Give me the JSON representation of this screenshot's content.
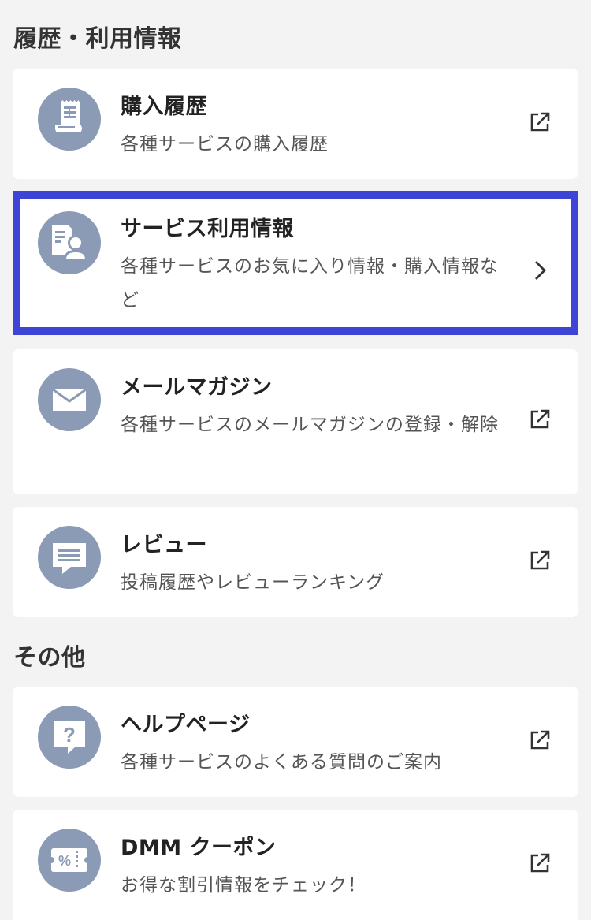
{
  "sections": [
    {
      "title": "履歴・利用情報",
      "items": [
        {
          "title": "購入履歴",
          "description": "各種サービスの購入履歴",
          "icon": "receipt-icon",
          "action_icon": "external-link-icon"
        },
        {
          "title": "サービス利用情報",
          "description": "各種サービスのお気に入り情報・購入情報など",
          "icon": "user-document-icon",
          "action_icon": "chevron-right-icon"
        },
        {
          "title": "メールマガジン",
          "description": "各種サービスのメールマガジンの登録・解除",
          "icon": "mail-icon",
          "action_icon": "external-link-icon"
        },
        {
          "title": "レビュー",
          "description": "投稿履歴やレビューランキング",
          "icon": "comment-icon",
          "action_icon": "external-link-icon"
        }
      ]
    },
    {
      "title": "その他",
      "items": [
        {
          "title": "ヘルプページ",
          "description": "各種サービスのよくある質問のご案内",
          "icon": "help-question-icon",
          "action_icon": "external-link-icon"
        },
        {
          "title": "DMM クーポン",
          "description": "お得な割引情報をチェック！",
          "icon": "coupon-icon",
          "action_icon": "external-link-icon"
        }
      ]
    }
  ],
  "colors": {
    "background": "#f3f3f3",
    "card": "#ffffff",
    "icon_circle": "#8b9bb5",
    "selection_border": "#3e45d6",
    "title_text": "#222222",
    "description_text": "#555555"
  }
}
